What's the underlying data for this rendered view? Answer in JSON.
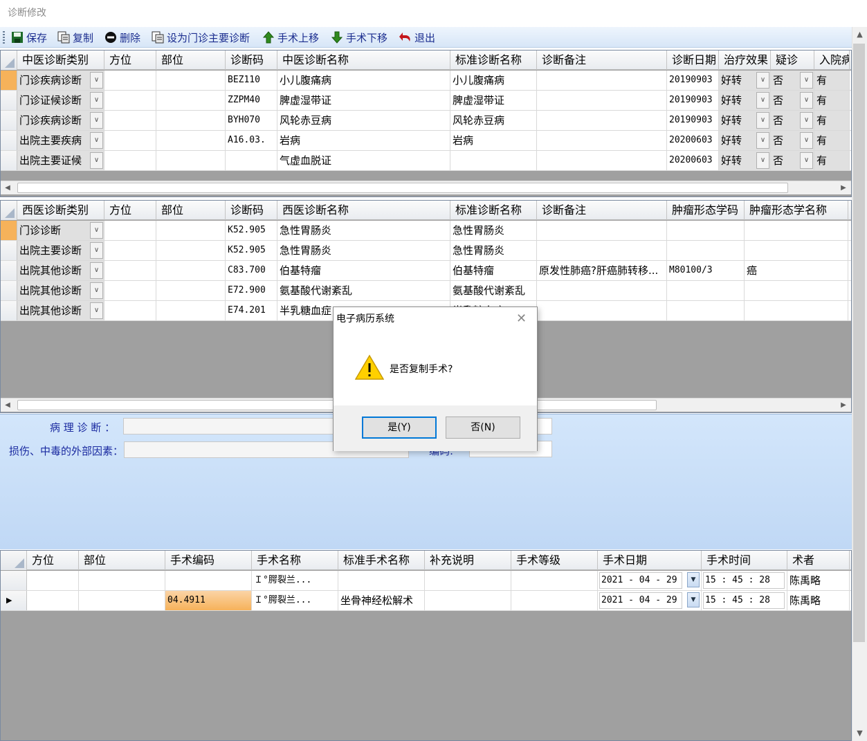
{
  "window": {
    "title": "诊断修改"
  },
  "toolbar": {
    "save": "保存",
    "copy": "复制",
    "delete": "删除",
    "set_main": "设为门诊主要诊断",
    "op_up": "手术上移",
    "op_down": "手术下移",
    "exit": "退出"
  },
  "tcm_grid": {
    "headers": [
      "中医诊断类别",
      "方位",
      "部位",
      "诊断码",
      "中医诊断名称",
      "标准诊断名称",
      "诊断备注",
      "诊断日期",
      "治疗效果",
      "疑诊",
      "入院病"
    ],
    "rows": [
      {
        "category": "门诊疾病诊断",
        "position": "",
        "part": "",
        "code": "BEZ110",
        "name": "小儿腹痛病",
        "std_name": "小儿腹痛病",
        "note": "",
        "date": "20190903",
        "effect": "好转",
        "suspect": "否",
        "admit": "有"
      },
      {
        "category": "门诊证候诊断",
        "position": "",
        "part": "",
        "code": "ZZPM40",
        "name": "脾虚湿带证",
        "std_name": "脾虚湿带证",
        "note": "",
        "date": "20190903",
        "effect": "好转",
        "suspect": "否",
        "admit": "有"
      },
      {
        "category": "门诊疾病诊断",
        "position": "",
        "part": "",
        "code": "BYH070",
        "name": "风轮赤豆病",
        "std_name": "风轮赤豆病",
        "note": "",
        "date": "20190903",
        "effect": "好转",
        "suspect": "否",
        "admit": "有"
      },
      {
        "category": "出院主要疾病",
        "position": "",
        "part": "",
        "code": "A16.03.",
        "name": "岩病",
        "std_name": "岩病",
        "note": "",
        "date": "20200603",
        "effect": "好转",
        "suspect": "否",
        "admit": "有"
      },
      {
        "category": "出院主要证候",
        "position": "",
        "part": "",
        "code": "",
        "name": "气虚血脱证",
        "std_name": "",
        "note": "",
        "date": "20200603",
        "effect": "好转",
        "suspect": "否",
        "admit": "有"
      }
    ]
  },
  "wm_grid": {
    "headers": [
      "西医诊断类别",
      "方位",
      "部位",
      "诊断码",
      "西医诊断名称",
      "标准诊断名称",
      "诊断备注",
      "肿瘤形态学码",
      "肿瘤形态学名称"
    ],
    "rows": [
      {
        "category": "门诊诊断",
        "position": "",
        "part": "",
        "code": "K52.905",
        "name": "急性胃肠炎",
        "std_name": "急性胃肠炎",
        "note": "",
        "morph_code": "",
        "morph_name": ""
      },
      {
        "category": "出院主要诊断",
        "position": "",
        "part": "",
        "code": "K52.905",
        "name": "急性胃肠炎",
        "std_name": "急性胃肠炎",
        "note": "",
        "morph_code": "",
        "morph_name": ""
      },
      {
        "category": "出院其他诊断",
        "position": "",
        "part": "",
        "code": "C83.700",
        "name": "伯基特瘤",
        "std_name": "伯基特瘤",
        "note": "原发性肺癌?肝癌肺转移...",
        "morph_code": "M80100/3",
        "morph_name": "癌"
      },
      {
        "category": "出院其他诊断",
        "position": "",
        "part": "",
        "code": "E72.900",
        "name": "氨基酸代谢紊乱",
        "std_name": "氨基酸代谢紊乱",
        "note": "",
        "morph_code": "",
        "morph_name": ""
      },
      {
        "category": "出院其他诊断",
        "position": "",
        "part": "",
        "code": "E74.201",
        "name": "半乳糖血症",
        "std_name": "半乳糖血症",
        "note": "",
        "morph_code": "",
        "morph_name": ""
      }
    ]
  },
  "mid": {
    "pathology_label": "病 理 诊 断 ：",
    "injury_label": "损伤、中毒的外部因素：",
    "code_label": "编码:",
    "pathology_value": "",
    "injury_value": ""
  },
  "op_grid": {
    "headers": [
      "方位",
      "部位",
      "手术编码",
      "手术名称",
      "标准手术名称",
      "补充说明",
      "手术等级",
      "手术日期",
      "手术时间",
      "术者"
    ],
    "rows": [
      {
        "position": "",
        "part": "",
        "code": "",
        "name": "Ｉ°腭裂兰...",
        "std_name": "",
        "supplement": "",
        "level": "",
        "date": "2021 - 04 - 29",
        "time": "15 : 45 : 28",
        "surgeon": "陈禹略"
      },
      {
        "position": "",
        "part": "",
        "code": "04.4911",
        "name": "Ｉ°腭裂兰...",
        "std_name": "坐骨神经松解术",
        "supplement": "",
        "level": "",
        "date": "2021 - 04 - 29",
        "time": "15 : 45 : 28",
        "surgeon": "陈禹略"
      }
    ]
  },
  "dialog": {
    "title": "电子病历系统",
    "message": "是否复制手术?",
    "yes": "是(Y)",
    "no": "否(N)"
  },
  "colors": {
    "selected_row": "#f6b25a",
    "toolbar_text": "#1b2d8f",
    "panel_bg": "#c9dff8",
    "grid_empty": "#a0a0a0"
  }
}
